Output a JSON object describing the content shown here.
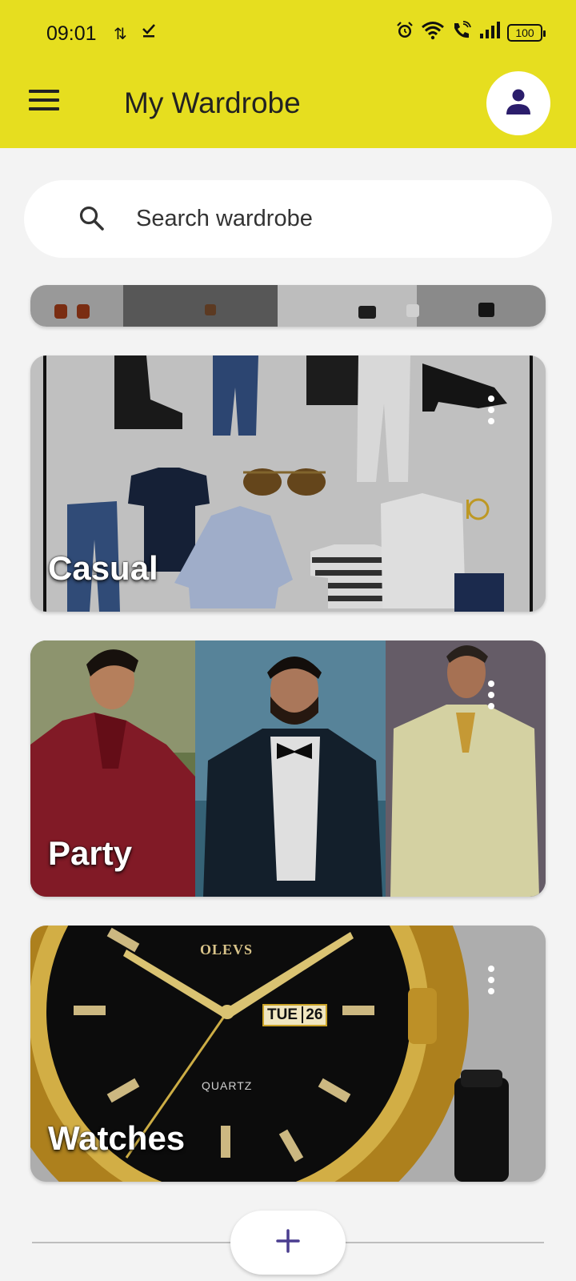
{
  "status_bar": {
    "time": "09:01",
    "battery": "100"
  },
  "header": {
    "title": "My Wardrobe",
    "menu_icon": "hamburger-menu-icon",
    "profile_icon": "person-icon"
  },
  "search": {
    "placeholder": "Search wardrobe",
    "icon": "search-icon"
  },
  "wardrobes": [
    {
      "label": "Casual"
    },
    {
      "label": "Party"
    },
    {
      "label": "Watches"
    }
  ],
  "watch_face": {
    "brand": "OLEVS",
    "day": "TUE",
    "date": "26",
    "movement": "QUARTZ"
  },
  "add_button": {
    "icon": "plus-icon"
  },
  "colors": {
    "appbar": "#e6de1f",
    "accent": "#4a3d8f",
    "background": "#f3f3f3"
  }
}
